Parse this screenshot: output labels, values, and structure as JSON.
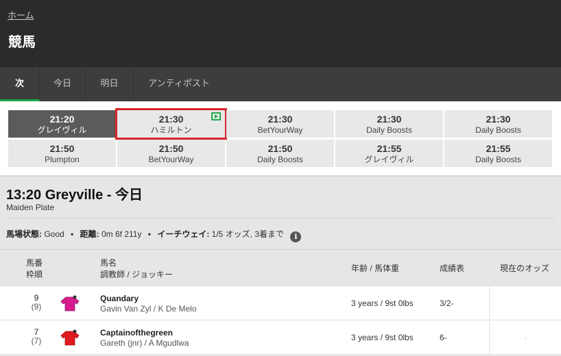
{
  "header": {
    "breadcrumb": "ホーム",
    "title": "競馬"
  },
  "tabs": [
    {
      "label": "次",
      "active": true
    },
    {
      "label": "今日",
      "active": false
    },
    {
      "label": "明日",
      "active": false
    },
    {
      "label": "アンティポスト",
      "active": false
    }
  ],
  "races": [
    {
      "time": "21:20",
      "name": "グレイヴィル",
      "active": true
    },
    {
      "time": "21:30",
      "name": "ハミルトン",
      "highlighted": true,
      "icon": "tv-icon"
    },
    {
      "time": "21:30",
      "name": "BetYourWay"
    },
    {
      "time": "21:30",
      "name": "Daily Boosts"
    },
    {
      "time": "21:30",
      "name": "Daily Boosts"
    },
    {
      "time": "21:50",
      "name": "Plumpton"
    },
    {
      "time": "21:50",
      "name": "BetYourWay"
    },
    {
      "time": "21:50",
      "name": "Daily Boosts"
    },
    {
      "time": "21:55",
      "name": "グレイヴィル"
    },
    {
      "time": "21:55",
      "name": "Daily Boosts"
    }
  ],
  "race_info": {
    "heading": "13:20 Greyville - 今日",
    "class": "Maiden Plate",
    "going_label": "馬場状態:",
    "going_value": "Good",
    "distance_label": "距離:",
    "distance_value": "0m 6f 211y",
    "ew_label": "イーチウェイ:",
    "ew_value": "1/5 オッズ, 3着まで",
    "info_icon": "i"
  },
  "table_headers": {
    "number": "馬番",
    "draw": "枠順",
    "horse": "馬名",
    "trainer_jockey": "調教師 / ジョッキー",
    "age_weight": "年齢 / 馬体重",
    "form": "成績表",
    "odds": "現在のオッズ"
  },
  "runners": [
    {
      "number": "9",
      "draw": "(9)",
      "name": "Quandary",
      "trainer_jockey": "Gavin Van Zyl / K De Melo",
      "age_weight": "3 years / 9st 0lbs",
      "form": "3/2-",
      "odds": "-",
      "silk_color": "#d81b8c",
      "silk_trim": "#8a1a6a",
      "silk_icon": "jockey-silk-icon"
    },
    {
      "number": "7",
      "draw": "(7)",
      "name": "Captainofthegreen",
      "trainer_jockey": "Gareth (jnr) / A Mgudlwa",
      "age_weight": "3 years / 9st 0lbs",
      "form": "6-",
      "odds": "-",
      "silk_color": "#e0191e",
      "silk_trim": "#9c0f12",
      "silk_icon": "jockey-silk-icon"
    }
  ]
}
